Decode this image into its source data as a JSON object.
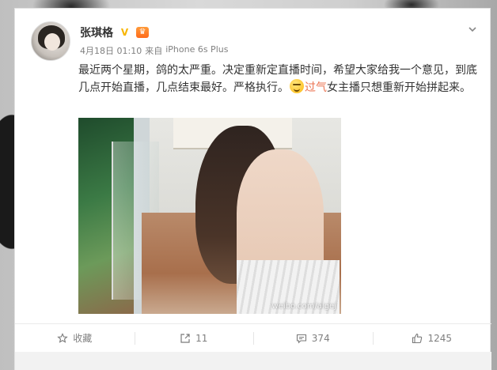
{
  "user": {
    "name": "张琪格",
    "verified_badge": "V",
    "vip_badge": "♛"
  },
  "post": {
    "timestamp": "4月18日 01:10",
    "source_prefix": "来自",
    "source": "iPhone 6s Plus",
    "text_part1": "最近两个星期，鸽的太严重。决定重新定直播时间，希望大家给我一个意见，到底几点开始直播，几点结束最好。严格执行。",
    "highlight": "过气",
    "text_part2": "女主播只想重新开始拼起来。",
    "image_watermark": "weibo.com/aigej"
  },
  "actions": {
    "favorite_label": "收藏",
    "repost_count": "11",
    "comment_count": "374",
    "like_count": "1245"
  }
}
